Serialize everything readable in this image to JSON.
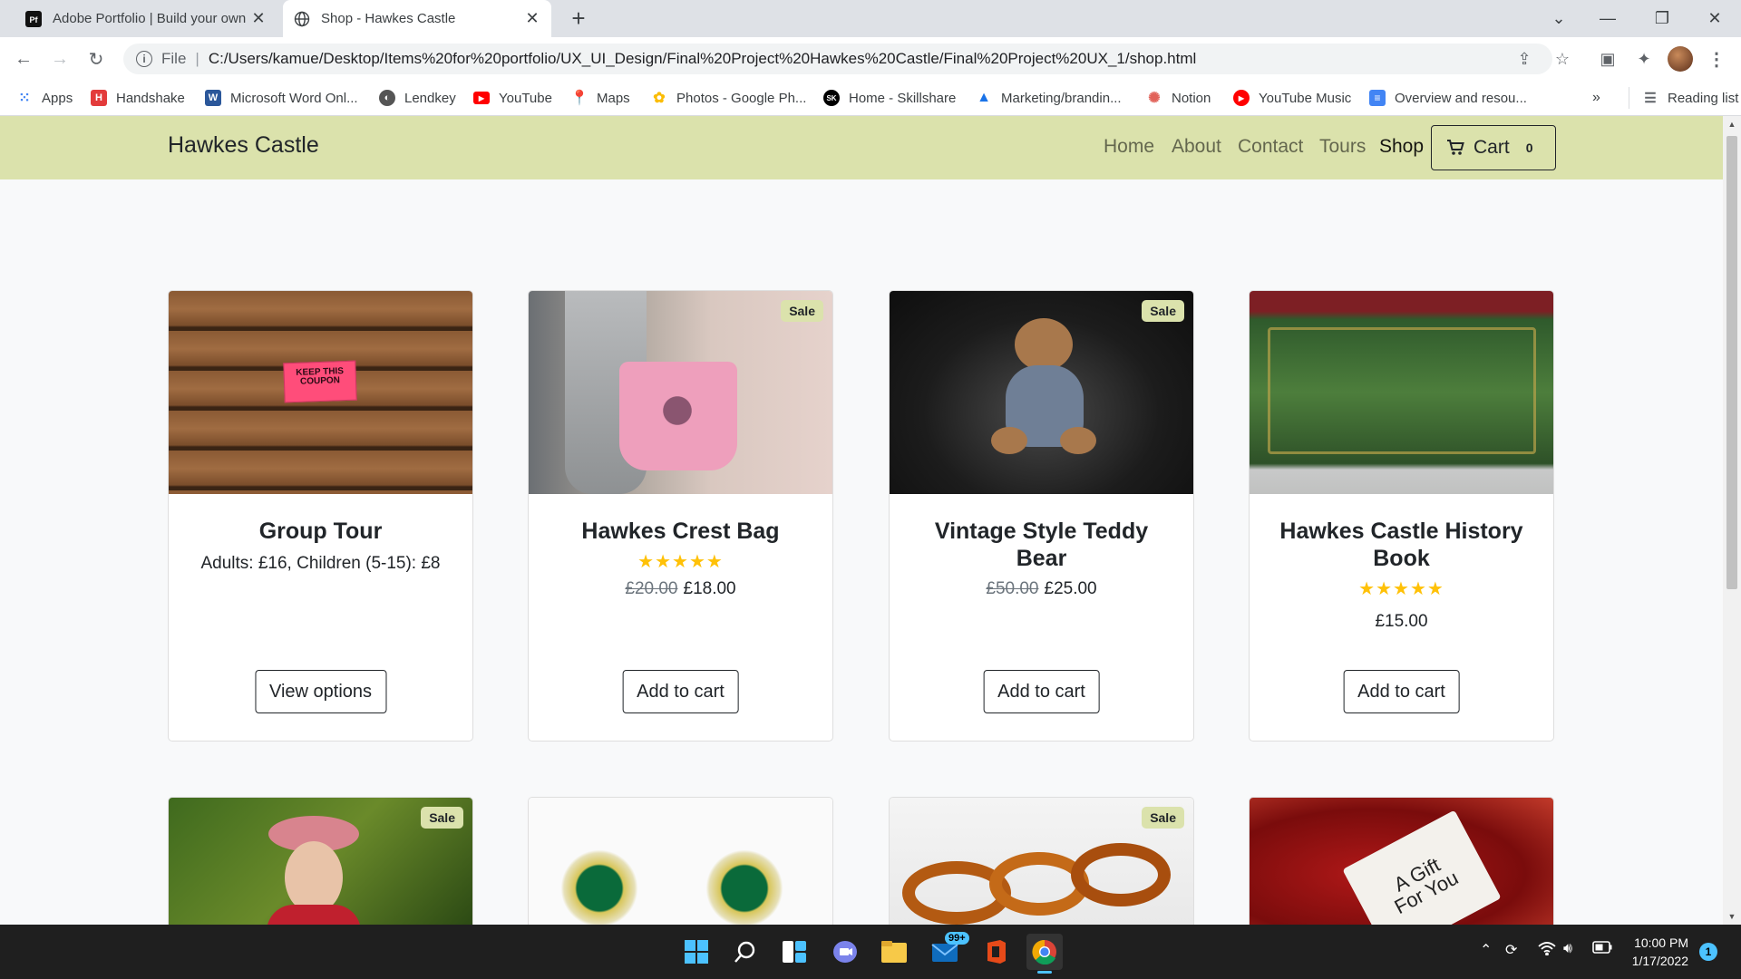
{
  "browser": {
    "tabs": [
      {
        "title": "Adobe Portfolio | Build your own",
        "icon": "adobe-portfolio-icon"
      },
      {
        "title": "Shop - Hawkes Castle",
        "icon": "globe-icon"
      }
    ],
    "address": {
      "scheme_label": "File",
      "url": "C:/Users/kamue/Desktop/Items%20for%20portfolio/UX_UI_Design/Final%20Project%20Hawkes%20Castle/Final%20Project%20UX_1/shop.html"
    },
    "bookmarks": [
      {
        "label": "Apps",
        "icon": "apps-grid-icon",
        "color": "#4285f4"
      },
      {
        "label": "Handshake",
        "icon": "handshake-icon",
        "color": "#e33b3b"
      },
      {
        "label": "Microsoft Word Onl...",
        "icon": "word-icon",
        "color": "#2b579a"
      },
      {
        "label": "Lendkey",
        "icon": "lendkey-icon",
        "color": "#555555"
      },
      {
        "label": "YouTube",
        "icon": "youtube-icon",
        "color": "#ff0000"
      },
      {
        "label": "Maps",
        "icon": "maps-icon",
        "color": "#34a853"
      },
      {
        "label": "Photos - Google Ph...",
        "icon": "photos-icon",
        "color": "#fbbc04"
      },
      {
        "label": "Home - Skillshare",
        "icon": "skillshare-icon",
        "color": "#000000"
      },
      {
        "label": "Marketing/brandin...",
        "icon": "drive-icon",
        "color": "#1a73e8"
      },
      {
        "label": "Notion",
        "icon": "notion-icon",
        "color": "#e16259"
      },
      {
        "label": "YouTube Music",
        "icon": "youtube-music-icon",
        "color": "#ff0000"
      },
      {
        "label": "Overview and resou...",
        "icon": "docs-icon",
        "color": "#4285f4"
      }
    ],
    "more_label": "»",
    "reading_list": "Reading list"
  },
  "site": {
    "brand": "Hawkes Castle",
    "nav": [
      "Home",
      "About",
      "Contact",
      "Tours",
      "Shop"
    ],
    "cart_label": "Cart",
    "cart_count": "0"
  },
  "products": [
    {
      "name": "Group Tour",
      "desc": "Adults: £16, Children (5-15): £8",
      "button": "View options",
      "sale": false,
      "image": "wood-coupon-photo"
    },
    {
      "name": "Hawkes Crest Bag",
      "stars": "★★★★★",
      "rating": 5,
      "old_price": "£20.00",
      "price": "£18.00",
      "button": "Add to cart",
      "sale": true,
      "image": "pink-bag-photo"
    },
    {
      "name": "Vintage Style Teddy Bear",
      "old_price": "£50.00",
      "price": "£25.00",
      "button": "Add to cart",
      "sale": true,
      "image": "teddy-bear-photo"
    },
    {
      "name": "Hawkes Castle History Book",
      "stars": "★★★★★",
      "rating": 5,
      "price": "£15.00",
      "button": "Add to cart",
      "sale": false,
      "image": "green-book-photo"
    }
  ],
  "products_row2": [
    {
      "sale": true,
      "image": "doll-photo"
    },
    {
      "sale": false,
      "image": "emerald-earrings-photo"
    },
    {
      "sale": true,
      "image": "amber-bracelet-photo"
    },
    {
      "sale": false,
      "image": "gift-tag-photo",
      "tag_text": "A Gift For You"
    }
  ],
  "sale_label": "Sale",
  "taskbar": {
    "mail_badge": "99+",
    "time": "10:00 PM",
    "date": "1/17/2022",
    "notifications": "1"
  }
}
